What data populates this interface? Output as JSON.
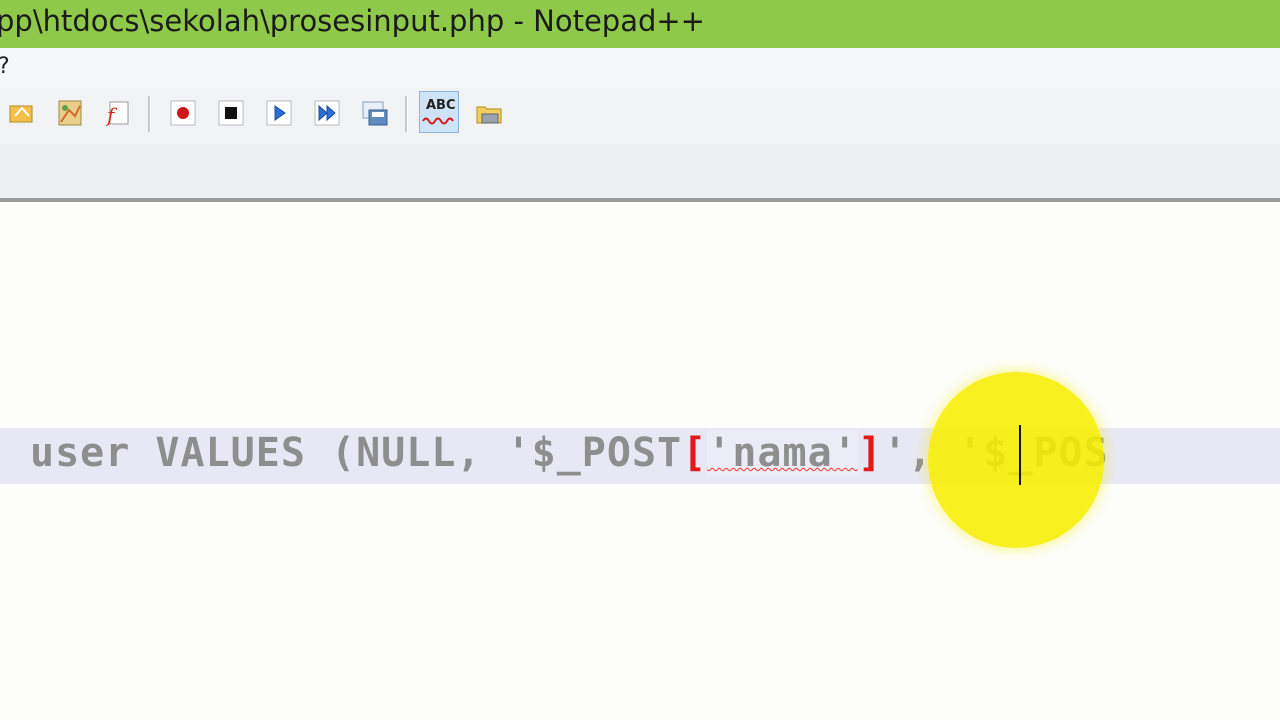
{
  "window": {
    "title": "pp\\htdocs\\sekolah\\prosesinput.php - Notepad++"
  },
  "menu": {
    "items": [
      {
        "label": "?"
      }
    ]
  },
  "toolbar": {
    "buttons": [
      {
        "name": "cut-icon"
      },
      {
        "name": "document-map-icon"
      },
      {
        "name": "function-list-icon"
      },
      {
        "name": "record-macro-icon"
      },
      {
        "name": "stop-recording-icon"
      },
      {
        "name": "playback-macro-icon"
      },
      {
        "name": "run-macro-multiple-icon"
      },
      {
        "name": "save-macro-icon"
      },
      {
        "name": "spell-check-icon",
        "label": "ABC",
        "active": true
      },
      {
        "name": "open-folder-icon"
      }
    ]
  },
  "editor": {
    "code": {
      "seg1": "user VALUES (NULL, '$_POST",
      "open_bracket": "[",
      "nama": "'nama'",
      "close_bracket": "]",
      "seg2": "', '$_POS"
    }
  },
  "colors": {
    "title_bar": "#8ec94a",
    "bracket_highlight": "#e21a1a",
    "code_text": "#8e8e8e",
    "current_line": "#e8e8f4",
    "cursor_highlight": "#f8ee00"
  }
}
